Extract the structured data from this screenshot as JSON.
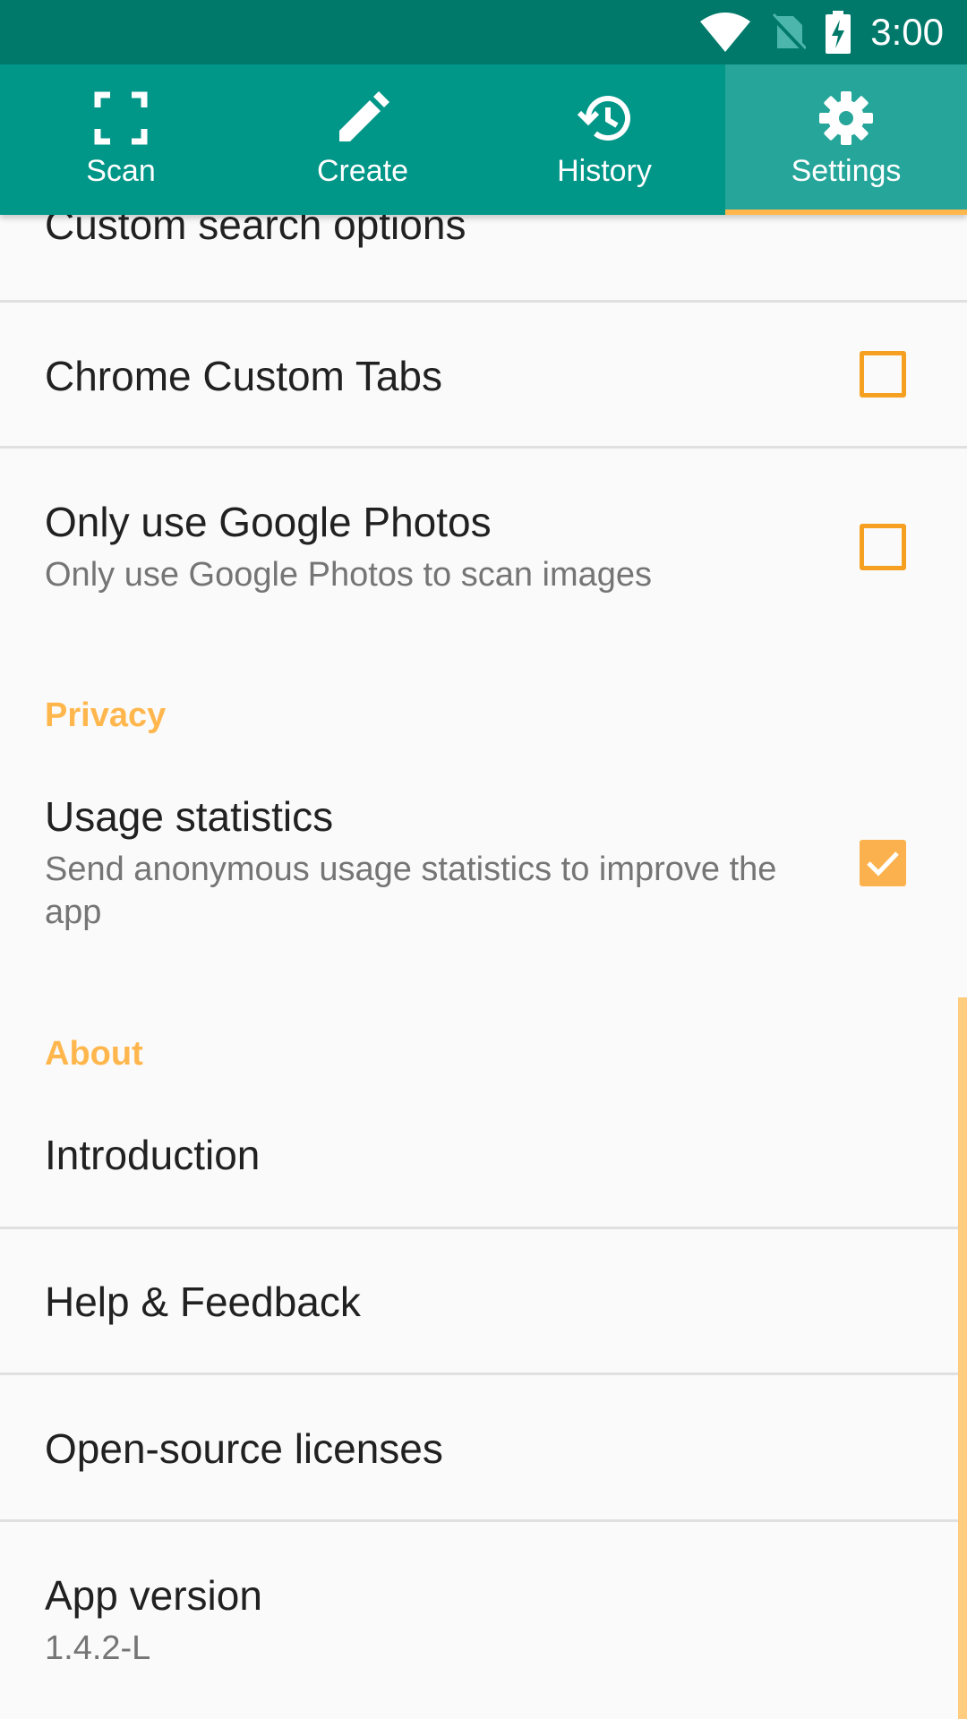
{
  "status_bar": {
    "time": "3:00",
    "icons": [
      "wifi-icon",
      "no-sim-icon",
      "battery-charging-icon"
    ]
  },
  "tabs": [
    {
      "label": "Scan",
      "icon": "scan-frame-icon",
      "active": false
    },
    {
      "label": "Create",
      "icon": "pencil-icon",
      "active": false
    },
    {
      "label": "History",
      "icon": "history-icon",
      "active": false
    },
    {
      "label": "Settings",
      "icon": "gear-icon",
      "active": true
    }
  ],
  "settings": {
    "custom_search_options": {
      "title": "Custom search options"
    },
    "chrome_custom_tabs": {
      "title": "Chrome Custom Tabs",
      "checked": false
    },
    "only_google_photos": {
      "title": "Only use Google Photos",
      "summary": "Only use Google Photos to scan images",
      "checked": false
    },
    "privacy_header": "Privacy",
    "usage_statistics": {
      "title": "Usage statistics",
      "summary": "Send anonymous usage statistics to improve the app",
      "checked": true
    },
    "about_header": "About",
    "introduction": {
      "title": "Introduction"
    },
    "help_feedback": {
      "title": "Help & Feedback"
    },
    "open_source": {
      "title": "Open-source licenses"
    },
    "app_version": {
      "title": "App version",
      "summary": "1.4.2-L"
    }
  },
  "colors": {
    "status_bar": "#00796b",
    "tab_bar": "#009688",
    "tab_active": "#26a69a",
    "accent": "#ffb74d",
    "checkbox": "#f5a020"
  }
}
